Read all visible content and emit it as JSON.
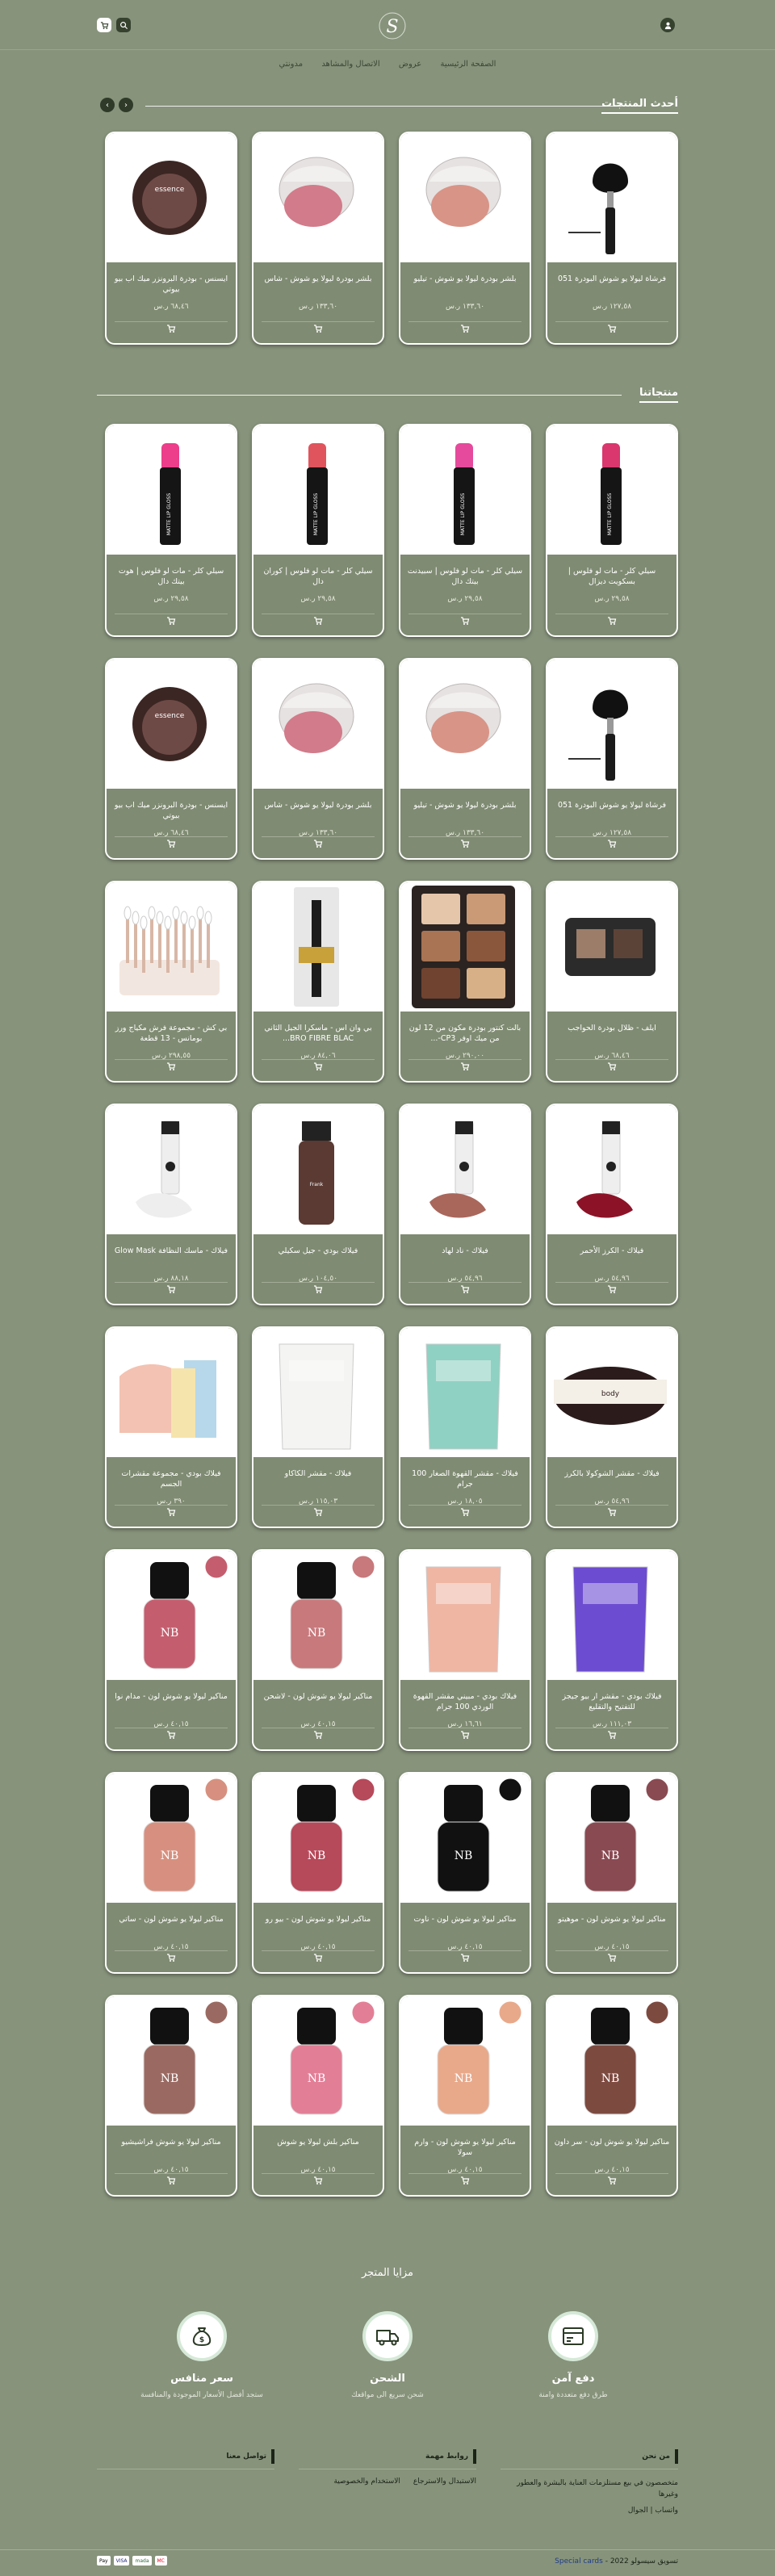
{
  "header": {
    "logo_letter": "S",
    "cart_icon": "cart-icon",
    "search_icon": "search-icon",
    "user_icon": "user-icon"
  },
  "nav": [
    "الصفحة الرئيسية",
    "عروض",
    "الاتصال والمشاهد",
    "مدونتي"
  ],
  "latest": {
    "title": "أحدث المنتجات",
    "products": [
      {
        "name": "فرشاة ليولا يو شوش البودرة 051",
        "price": "١٢٧,٥٨ ر.س",
        "art": "brush"
      },
      {
        "name": "بلشر بودرة ليولا يو شوش - تيليو",
        "price": "١٣٣,٦٠ ر.س",
        "art": "compact-peach"
      },
      {
        "name": "بلشر بودرة ليولا يو شوش - شاس",
        "price": "١٣٣,٦٠ ر.س",
        "art": "compact-pink"
      },
      {
        "name": "ايسنس - بودرة البرونزر ميك اب بيو بيوتي",
        "price": "٦٨,٤٦ ر.س",
        "art": "bronzer"
      }
    ]
  },
  "ours": {
    "title": "منتجاتنا",
    "rows": [
      [
        {
          "name": "سيلي كلر - مات لو فلوس | بسكويت ديزال",
          "price": "٢٩,٥٨ ر.س",
          "art": "lip-pink"
        },
        {
          "name": "سيلي كلر - مات لو فلوس | سبيدنت بيتك دال",
          "price": "٢٩,٥٨ ر.س",
          "art": "lip-magenta"
        },
        {
          "name": "سيلي كلر - مات لو فلوس | كوران دال",
          "price": "٢٩,٥٨ ر.س",
          "art": "lip-coral"
        },
        {
          "name": "سيلي كلر - مات لو فلوس | هوت بيتك دال",
          "price": "٢٩,٥٨ ر.س",
          "art": "lip-hot"
        }
      ],
      [
        {
          "name": "فرشاة ليولا يو شوش البودرة 051",
          "price": "١٢٧,٥٨ ر.س",
          "art": "brush"
        },
        {
          "name": "بلشر بودرة ليولا يو شوش - تيليو",
          "price": "١٣٣,٦٠ ر.س",
          "art": "compact-peach"
        },
        {
          "name": "بلشر بودرة ليولا يو شوش - شاس",
          "price": "١٣٣,٦٠ ر.س",
          "art": "compact-pink"
        },
        {
          "name": "ايسنس - بودرة البرونزر ميك اب بيو بيوتي",
          "price": "٦٨,٤٦ ر.س",
          "art": "bronzer"
        }
      ],
      [
        {
          "name": "ايلف - ظلال بودرة الحواجب",
          "price": "٦٨,٤٦ ر.س",
          "art": "brow-kit"
        },
        {
          "name": "بالت كنتور بودرة مكون من 12 لون من ميك اوفر CP3-...",
          "price": "٢٩٠,٠٠ ر.س",
          "art": "contour"
        },
        {
          "name": "بي وان اس - ماسكرا الجيل الثاني BRO FIBRE BLAC...",
          "price": "٨٤,٠٦ ر.س",
          "art": "mascara"
        },
        {
          "name": "بي كش - مجموعة فرش مكياج ورز بومانس - 13 قطعة",
          "price": "٢٩٨,٥٥ ر.س",
          "art": "brush-set"
        }
      ],
      [
        {
          "name": "فيلاك - الكرز الأحمر",
          "price": "٥٤,٩٦ ر.س",
          "art": "tube-red"
        },
        {
          "name": "فيلاك - ناد لهاد",
          "price": "٥٤,٩٦ ر.س",
          "art": "tube-nude"
        },
        {
          "name": "فيلاك بودي - جيل سكيلي",
          "price": "١٠٤,٥٠ ر.س",
          "art": "bottle-dark"
        },
        {
          "name": "فيلاك - ماسك النظافة Glow Mask",
          "price": "٨٨,١٨ ر.س",
          "art": "tube-white"
        }
      ],
      [
        {
          "name": "فيلاك - مقشر الشوكولا بالكرز",
          "price": "٥٤,٩٦ ر.س",
          "art": "tin"
        },
        {
          "name": "فيلاك - مقشر القهوة الصغار 100 جرام",
          "price": "١٨,٠٥ ر.س",
          "art": "pouch-mint"
        },
        {
          "name": "فيلاك - مقشر الكاكاو",
          "price": "١١٥,٠٣ ر.س",
          "art": "pouch-white"
        },
        {
          "name": "فيلاك بودي - مجموعة مقشرات الجسم",
          "price": "٣٩٠ ر.س",
          "art": "bundle"
        }
      ],
      [
        {
          "name": "فيلاك بودي - مقشر ار بيو جيجز للتفتيح والتقليع",
          "price": "١١١,٠٣ ر.س",
          "art": "pouch-purple"
        },
        {
          "name": "فيلاك بودي - مبيني مقشر القهوة الوردي 100 جرام",
          "price": "١٦,٦١ ر.س",
          "art": "pouch-pink"
        },
        {
          "name": "مناكير ليولا يو شوش لون - لاشحن",
          "price": "٤٠,١٥ ر.س",
          "art": "polish-mauve"
        },
        {
          "name": "مناكير ليولا يو شوش لون - مدام نوا",
          "price": "٤٠,١٥ ر.س",
          "art": "polish-rose"
        }
      ],
      [
        {
          "name": "مناكير ليولا يو شوش لون - موهيتو",
          "price": "٤٠,١٥ ر.س",
          "art": "polish-deep"
        },
        {
          "name": "مناكير ليولا يو شوش لون - ناوت",
          "price": "٤٠,١٥ ر.س",
          "art": "polish-black"
        },
        {
          "name": "مناكير ليولا يو شوش لون - بيو رو",
          "price": "٤٠,١٥ ر.س",
          "art": "polish-berry"
        },
        {
          "name": "مناكير ليولا يو شوش لون - ساتي",
          "price": "٤٠,١٥ ر.س",
          "art": "polish-nude"
        }
      ],
      [
        {
          "name": "مناكير ليولا يو شوش لون - سر داون",
          "price": "٤٠,١٥ ر.س",
          "art": "polish-brown"
        },
        {
          "name": "مناكير ليولا يو شوش لون - وارم سولا",
          "price": "٤٠,١٥ ر.س",
          "art": "polish-peach"
        },
        {
          "name": "مناكير بلش ليولا يو شوش",
          "price": "٤٠,١٥ ر.س",
          "art": "polish-pink"
        },
        {
          "name": "مناكير ليولا يو شوش فراشيشيو",
          "price": "٤٠,١٥ ر.س",
          "art": "polish-taupe"
        }
      ]
    ]
  },
  "features": {
    "title": "مزايا المتجر",
    "items": [
      {
        "title": "دفع آمن",
        "sub": "طرق دفع متعددة وامنة",
        "icon": "payment-card-icon"
      },
      {
        "title": "الشحن",
        "sub": "شحن سريع الى مواقعك",
        "icon": "delivery-truck-icon"
      },
      {
        "title": "سعر منافس",
        "sub": "ستجد أفضل الأسعار الموجودة والمنافسة",
        "icon": "money-bag-icon"
      }
    ]
  },
  "footer": {
    "about": {
      "title": "من نحن",
      "text": "متخصصون في بيع مستلزمات العناية بالبشرة والعطور وغيرها",
      "whatsapp": "واتساب",
      "mobile": "الجوال"
    },
    "links": {
      "title": "روابط مهمة",
      "items": [
        "الاستبدال والاسترجاع",
        "الاستخدام والخصوصية"
      ]
    },
    "contact": {
      "title": "تواصل معنا"
    },
    "copyright_prefix": "تسويق سيسولو",
    "year": "2022",
    "brand": "Special cards",
    "payments": [
      "Pay",
      "VISA",
      "mada",
      "MC"
    ]
  },
  "colors": {
    "background": "#87937b",
    "card": "#7f8b72",
    "dark": "#36422e"
  }
}
